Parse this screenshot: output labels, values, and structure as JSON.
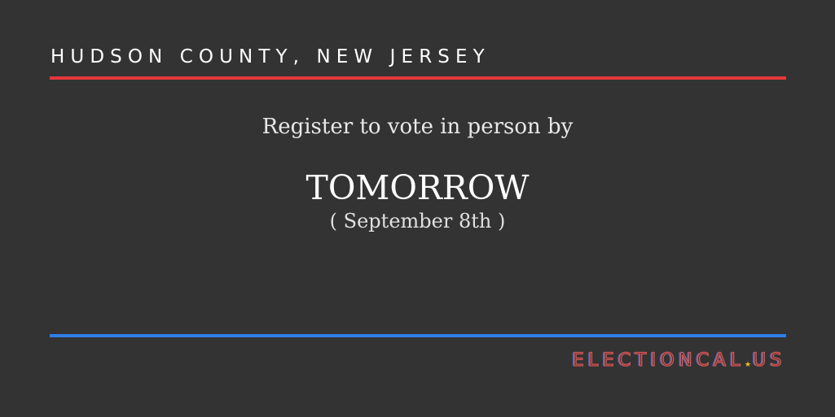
{
  "header": {
    "location": "HUDSON COUNTY, NEW JERSEY"
  },
  "message": {
    "lead": "Register to vote in person by",
    "deadline": "TOMORROW",
    "date": "( September 8th )"
  },
  "brand": {
    "name": "ELECTIONCAL",
    "tld": "US",
    "star_icon": "star-icon"
  },
  "colors": {
    "background": "#333333",
    "red_rule": "#e5383b",
    "blue_rule": "#2f7fe8",
    "brand_red": "#d9534f",
    "brand_blue": "#4a72c7",
    "star": "#f2c318"
  }
}
